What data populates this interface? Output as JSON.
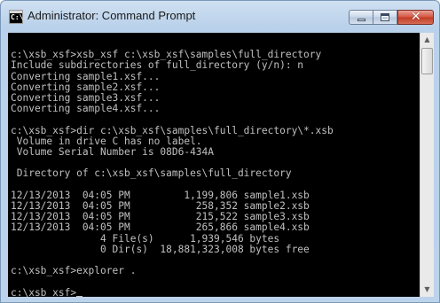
{
  "window": {
    "title": "Administrator: Command Prompt",
    "icon": "cmd-icon",
    "icon_glyph": "C:\\"
  },
  "caption_buttons": {
    "minimize_icon": "minimize-icon",
    "maximize_icon": "maximize-icon",
    "close_icon": "close-icon",
    "close_glyph": "✕"
  },
  "console": {
    "lines": [
      "",
      "c:\\xsb_xsf>xsb_xsf c:\\xsb_xsf\\samples\\full_directory",
      "Include subdirectories of full_directory (y/n): n",
      "Converting sample1.xsf...",
      "Converting sample2.xsf...",
      "Converting sample3.xsf...",
      "Converting sample4.xsf...",
      "",
      "c:\\xsb_xsf>dir c:\\xsb_xsf\\samples\\full_directory\\*.xsb",
      " Volume in drive C has no label.",
      " Volume Serial Number is 08D6-434A",
      "",
      " Directory of c:\\xsb_xsf\\samples\\full_directory",
      "",
      "12/13/2013  04:05 PM         1,199,806 sample1.xsb",
      "12/13/2013  04:05 PM           258,352 sample2.xsb",
      "12/13/2013  04:05 PM           215,522 sample3.xsb",
      "12/13/2013  04:05 PM           265,866 sample4.xsb",
      "               4 File(s)      1,939,546 bytes",
      "               0 Dir(s)  18,881,323,008 bytes free",
      "",
      "c:\\xsb_xsf>explorer .",
      "",
      "c:\\xsb_xsf>"
    ],
    "text_color": "#c0c0c0",
    "background_color": "#000000"
  },
  "scrollbar": {
    "up_icon": "scroll-up-arrow-icon",
    "down_icon": "scroll-down-arrow-icon",
    "up_glyph": "▲",
    "down_glyph": "▼"
  }
}
